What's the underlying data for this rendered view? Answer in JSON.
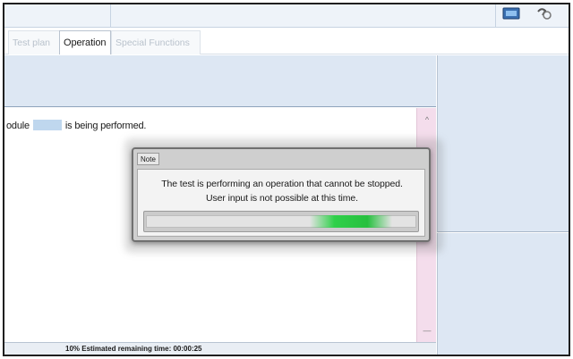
{
  "tabs": [
    {
      "label": "Test plan",
      "active": false
    },
    {
      "label": "Operation",
      "active": true
    },
    {
      "label": "Special Functions",
      "active": false
    }
  ],
  "content": {
    "module_prefix": "odule",
    "module_suffix": "is being performed."
  },
  "status": {
    "text": "10% Estimated remaining time: 00:00:25",
    "progress_percent": 10
  },
  "modal": {
    "title": "Note",
    "line1": "The test is performing an operation that cannot be stopped.",
    "line2": "User input is not possible at this time.",
    "progress_chunk_start": 0.6,
    "progress_chunk_end": 0.9
  },
  "scroll": {
    "up_glyph": "^",
    "down_glyph": "―"
  },
  "colors": {
    "accent_green": "#2fd049",
    "panel_blue": "#dde7f3",
    "scroll_pink": "#f4ddec"
  },
  "icons": [
    "toolbar-screen-icon",
    "toolbar-help-icon",
    "scroll-up-icon",
    "scroll-down-icon"
  ]
}
